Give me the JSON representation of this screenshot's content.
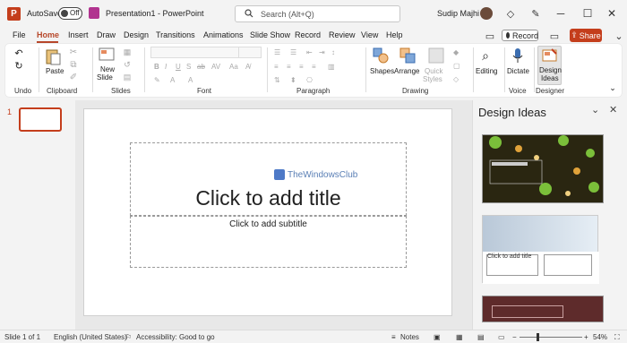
{
  "title_bar": {
    "autosave_label": "AutoSave",
    "autosave_state": "Off",
    "document_title": "Presentation1 - PowerPoint",
    "search_placeholder": "Search (Alt+Q)",
    "user_name": "Sudip Majhi"
  },
  "tabs": [
    "File",
    "Home",
    "Insert",
    "Draw",
    "Design",
    "Transitions",
    "Animations",
    "Slide Show",
    "Record",
    "Review",
    "View",
    "Help"
  ],
  "active_tab": "Home",
  "record_label": "Record",
  "share_label": "Share",
  "ribbon": {
    "undo_group": "Undo",
    "clipboard": {
      "label": "Clipboard",
      "paste": "Paste"
    },
    "slides": {
      "label": "Slides",
      "new_slide": "New",
      "new_slide2": "Slide"
    },
    "font": {
      "label": "Font"
    },
    "paragraph": {
      "label": "Paragraph"
    },
    "drawing": {
      "label": "Drawing",
      "shapes": "Shapes",
      "arrange": "Arrange",
      "quick_styles": "Quick",
      "quick_styles2": "Styles"
    },
    "editing": {
      "label": "Editing"
    },
    "voice": {
      "label": "Voice",
      "dictate": "Dictate"
    },
    "designer": {
      "label": "Designer",
      "design_ideas": "Design",
      "design_ideas2": "Ideas"
    }
  },
  "slides_panel": {
    "slide_number": "1"
  },
  "slide": {
    "title_placeholder": "Click to add title",
    "subtitle_placeholder": "Click to add subtitle",
    "watermark": "TheWindowsClub"
  },
  "design_pane": {
    "title": "Design Ideas",
    "idea2_text": "Click to add title"
  },
  "status_bar": {
    "slide_info": "Slide 1 of 1",
    "language": "English (United States)",
    "accessibility": "Accessibility: Good to go",
    "notes": "Notes",
    "zoom": "54%"
  },
  "colors": {
    "accent": "#c43e1c",
    "tab_active": "#b7472a"
  }
}
